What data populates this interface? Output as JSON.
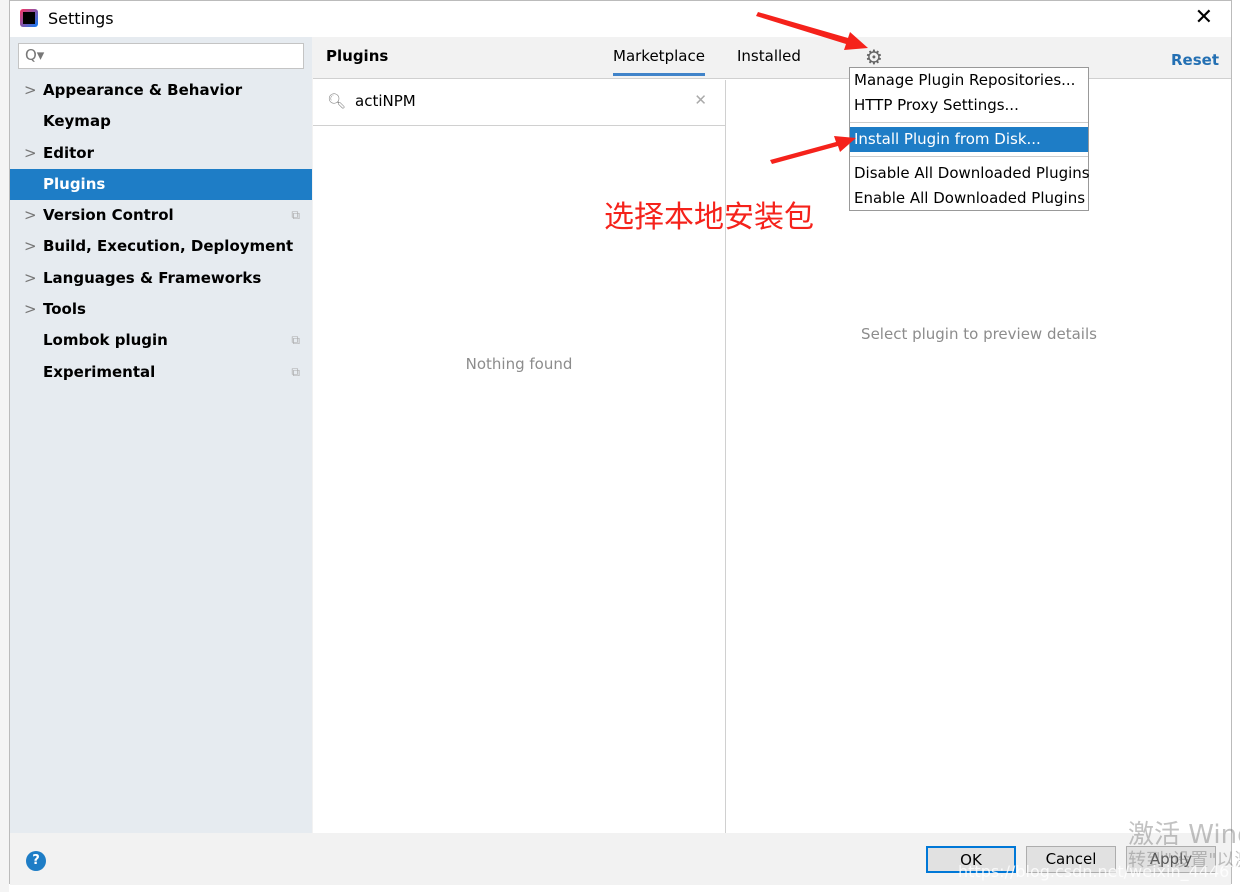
{
  "window": {
    "title": "Settings",
    "close_icon": "close-icon"
  },
  "sidebar": {
    "search_placeholder": "Q▾",
    "items": [
      {
        "label": "Appearance & Behavior",
        "expandable": true,
        "project": false
      },
      {
        "label": "Keymap",
        "expandable": false,
        "project": false
      },
      {
        "label": "Editor",
        "expandable": true,
        "project": false
      },
      {
        "label": "Plugins",
        "expandable": false,
        "project": false,
        "selected": true
      },
      {
        "label": "Version Control",
        "expandable": true,
        "project": true
      },
      {
        "label": "Build, Execution, Deployment",
        "expandable": true,
        "project": false
      },
      {
        "label": "Languages & Frameworks",
        "expandable": true,
        "project": false
      },
      {
        "label": "Tools",
        "expandable": true,
        "project": false
      },
      {
        "label": "Lombok plugin",
        "expandable": false,
        "project": true
      },
      {
        "label": "Experimental",
        "expandable": false,
        "project": true
      }
    ]
  },
  "main": {
    "title": "Plugins",
    "tabs": [
      {
        "label": "Marketplace",
        "active": true
      },
      {
        "label": "Installed",
        "active": false
      }
    ],
    "reset_label": "Reset",
    "search_value": "actiNPM",
    "empty_text": "Nothing found",
    "preview_text": "Select plugin to preview details"
  },
  "gear_menu": {
    "items": [
      "Manage Plugin Repositories...",
      "HTTP Proxy Settings...",
      "Install Plugin from Disk...",
      "Disable All Downloaded Plugins",
      "Enable All Downloaded Plugins"
    ],
    "selected": "Install Plugin from Disk..."
  },
  "annotation": "选择本地安装包",
  "footer": {
    "help": "?",
    "ok": "OK",
    "cancel": "Cancel",
    "apply": "Apply"
  },
  "watermarks": {
    "activate": "激活 Wind",
    "activate_sub": "转到\"设置\"以激",
    "url": "https://blog.csdn.net/weixin_44467567"
  },
  "colors": {
    "accent": "#1e7dc6",
    "annotation": "#f5221b",
    "link": "#2470b3"
  }
}
